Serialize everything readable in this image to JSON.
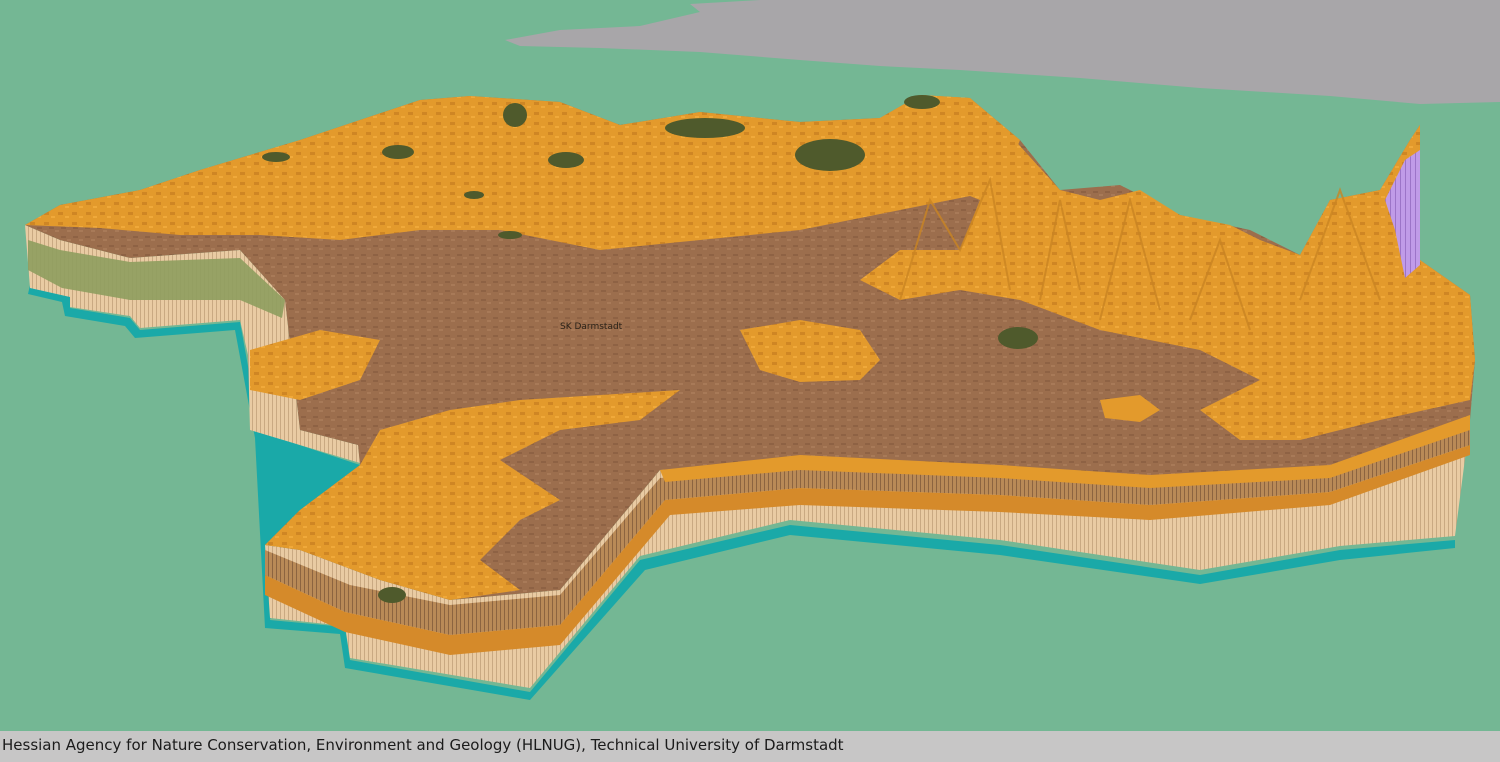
{
  "scene": {
    "map_label": "SK Darmstadt",
    "colors": {
      "background": "#74b794",
      "sky_cloud": "#a8a6a9",
      "terrain_orange": "#e39a2c",
      "terrain_brown": "#9c6e4d",
      "forest_dark": "#4f5a2c",
      "side_beige": "#e9cba3",
      "base_teal": "#1aa9a8",
      "layer_green": "#a8b57c",
      "layer_purple": "#b48fe0"
    }
  },
  "caption": {
    "text": "Hessian Agency for Nature Conservation, Environment and Geology (HLNUG), Technical University of Darmstadt"
  }
}
